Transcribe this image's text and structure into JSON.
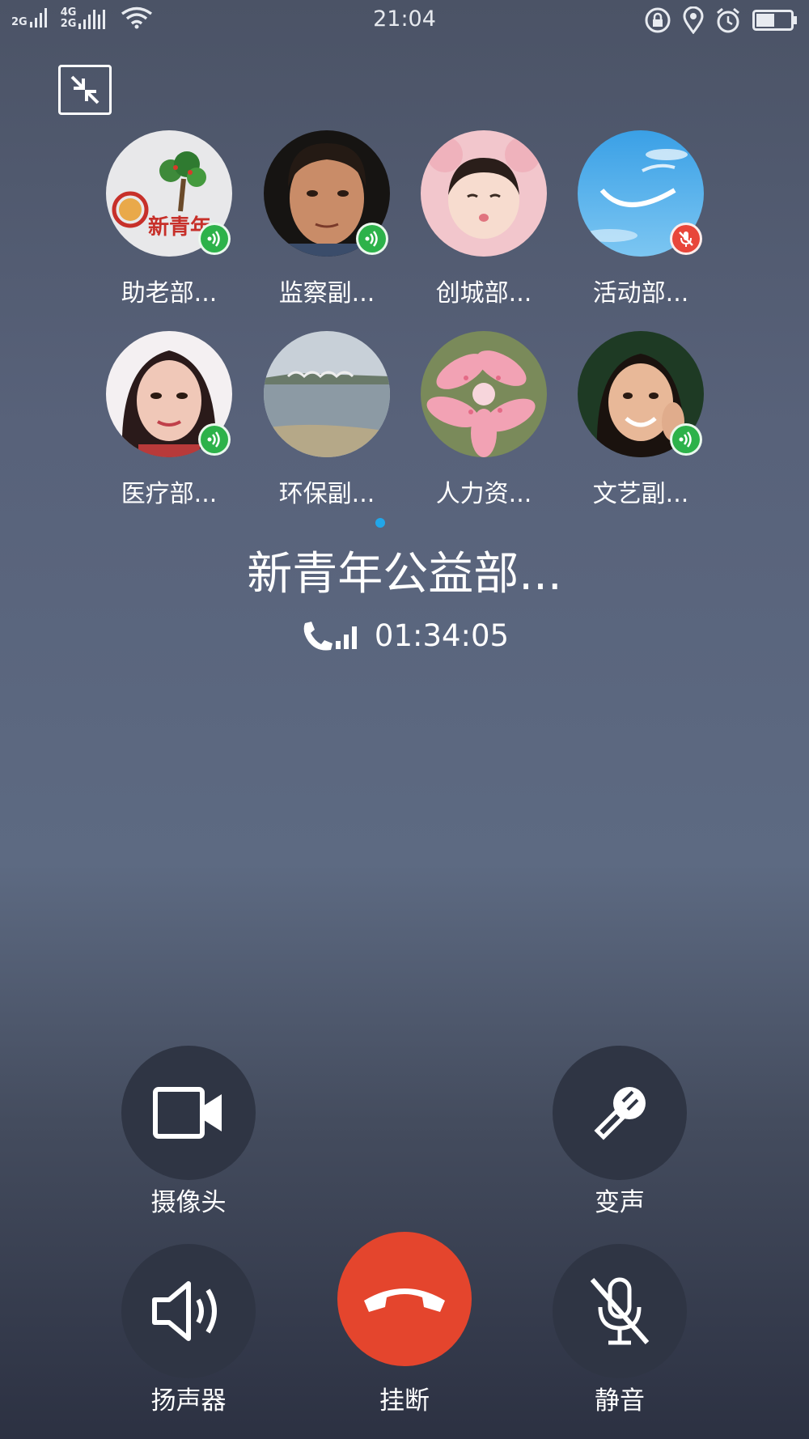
{
  "status_bar": {
    "time": "21:04",
    "net_left": "2G",
    "net_right_top": "4G",
    "net_right_bottom": "2G"
  },
  "group": {
    "title": "新青年公益部...",
    "call_duration": "01:34:05"
  },
  "members": [
    {
      "name": "助老部...",
      "status": "speaking"
    },
    {
      "name": "监察副...",
      "status": "speaking"
    },
    {
      "name": "创城部...",
      "status": "none"
    },
    {
      "name": "活动部...",
      "status": "muted"
    },
    {
      "name": "医疗部...",
      "status": "speaking"
    },
    {
      "name": "环保副...",
      "status": "none"
    },
    {
      "name": "人力资...",
      "status": "none"
    },
    {
      "name": "文艺副...",
      "status": "speaking"
    }
  ],
  "avatar_image_text": "新青年",
  "controls": {
    "camera": "摄像头",
    "voice_change": "变声",
    "speaker": "扬声器",
    "hangup": "挂断",
    "mute": "静音"
  },
  "colors": {
    "speaking": "#2db24a",
    "muted": "#e8463a",
    "hangup": "#e4452d",
    "page_dot": "#22a6e8"
  }
}
